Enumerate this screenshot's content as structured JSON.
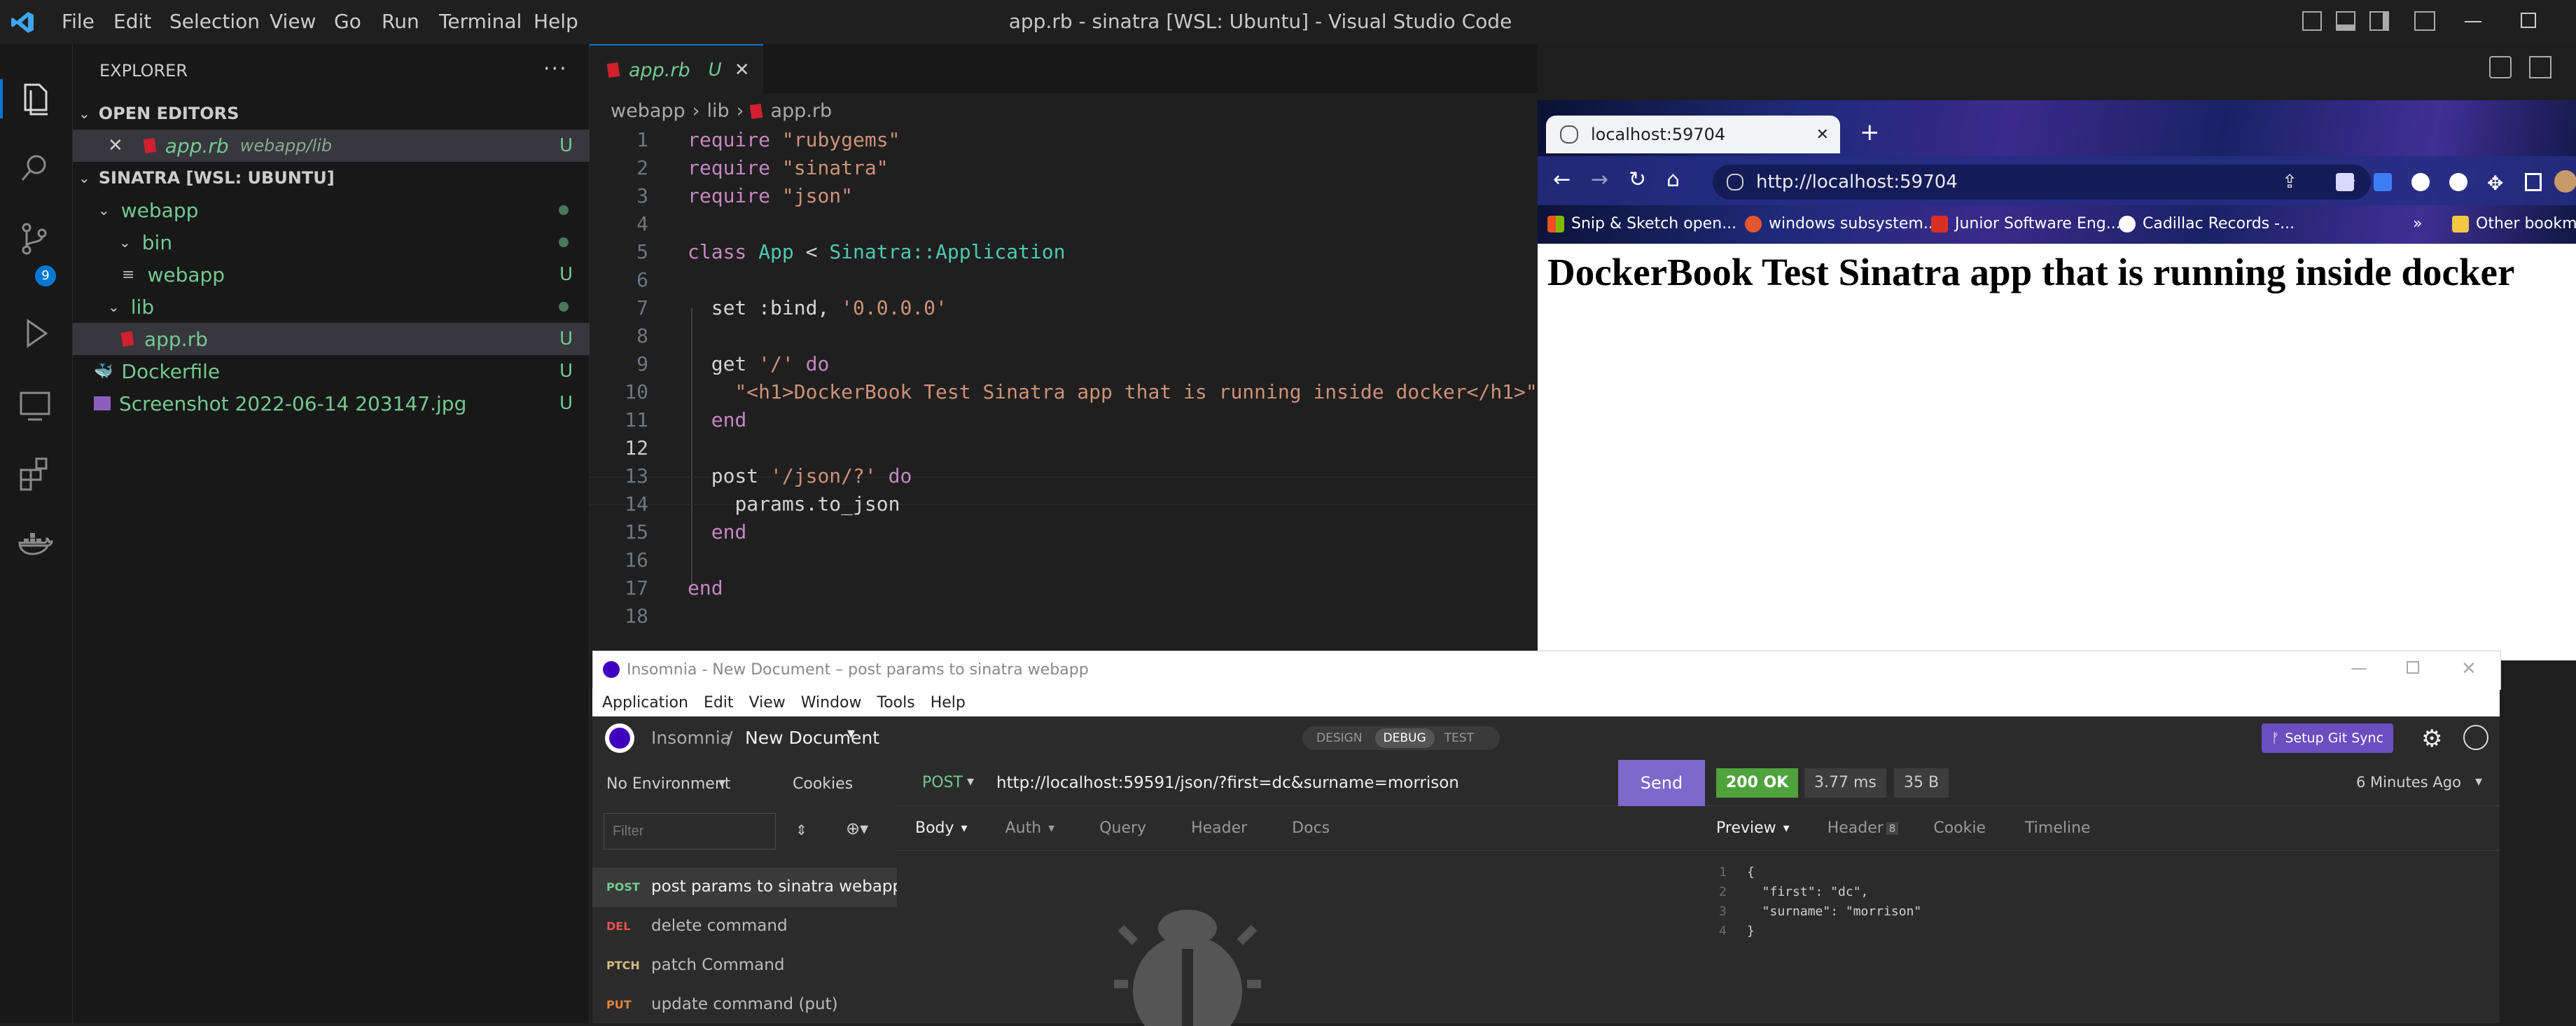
{
  "vscode": {
    "menu": [
      "File",
      "Edit",
      "Selection",
      "View",
      "Go",
      "Run",
      "Terminal",
      "Help"
    ],
    "window_title": "app.rb - sinatra [WSL: Ubuntu] - Visual Studio Code",
    "scm_badge": "9",
    "explorer": {
      "title": "EXPLORER",
      "open_editors_header": "OPEN EDITORS",
      "open_editor": {
        "name": "app.rb",
        "path": "webapp/lib",
        "status": "U"
      },
      "folder_header": "SINATRA [WSL: UBUNTU]",
      "tree": [
        {
          "name": "webapp",
          "kind": "folder",
          "status": "dot"
        },
        {
          "name": "bin",
          "kind": "folder",
          "status": "dot"
        },
        {
          "name": "webapp",
          "kind": "file",
          "status": "U"
        },
        {
          "name": "lib",
          "kind": "folder",
          "status": "dot"
        },
        {
          "name": "app.rb",
          "kind": "ruby",
          "status": "U"
        },
        {
          "name": "Dockerfile",
          "kind": "docker",
          "status": "U"
        },
        {
          "name": "Screenshot 2022-06-14 203147.jpg",
          "kind": "image",
          "status": "U"
        }
      ]
    },
    "tab": {
      "name": "app.rb",
      "status": "U"
    },
    "breadcrumb": [
      "webapp",
      "lib",
      "app.rb"
    ],
    "code_lines": [
      "1",
      "2",
      "3",
      "4",
      "5",
      "6",
      "7",
      "8",
      "9",
      "10",
      "11",
      "12",
      "13",
      "14",
      "15",
      "16",
      "17",
      "18"
    ]
  },
  "browser": {
    "tab_title": "localhost:59704",
    "url": "http://localhost:59704",
    "bookmarks": [
      "Snip & Sketch open...",
      "windows subsystem...",
      "Junior Software Eng...",
      "Cadillac Records -...",
      "Other bookma"
    ],
    "heading": "DockerBook Test Sinatra app that is running inside docker"
  },
  "insomnia": {
    "window_title": "Insomnia - New Document – post params to sinatra webapp",
    "menu": [
      "Application",
      "Edit",
      "View",
      "Window",
      "Tools",
      "Help"
    ],
    "breadcrumb_app": "Insomnia",
    "breadcrumb_sep": "/",
    "document": "New Document",
    "modes": [
      "DESIGN",
      "DEBUG",
      "TEST"
    ],
    "setup_git_sync": "Setup Git Sync",
    "environment": "No Environment",
    "cookies": "Cookies",
    "filter_placeholder": "Filter",
    "requests": [
      {
        "method": "POST",
        "name": "post params to sinatra webapp",
        "color": "#73c991"
      },
      {
        "method": "DEL",
        "name": "delete command",
        "color": "#e5534b"
      },
      {
        "method": "PTCH",
        "name": "patch Command",
        "color": "#d7ba7d"
      },
      {
        "method": "PUT",
        "name": "update command (put)",
        "color": "#e0843c"
      }
    ],
    "method": "POST",
    "url": "http://localhost:59591/json/?first=dc&surname=morrison",
    "send": "Send",
    "status": "200 OK",
    "time": "3.77 ms",
    "size": "35 B",
    "age": "6 Minutes Ago",
    "request_tabs": [
      "Body",
      "Auth",
      "Query",
      "Header",
      "Docs"
    ],
    "response_tabs": [
      "Preview",
      "Header",
      "Cookie",
      "Timeline"
    ],
    "response_header_count": "8",
    "response_lines": [
      "{",
      "  \"first\": \"dc\",",
      "  \"surname\": \"morrison\"",
      "}"
    ],
    "response_line_numbers": [
      "1",
      "2",
      "3",
      "4"
    ]
  }
}
